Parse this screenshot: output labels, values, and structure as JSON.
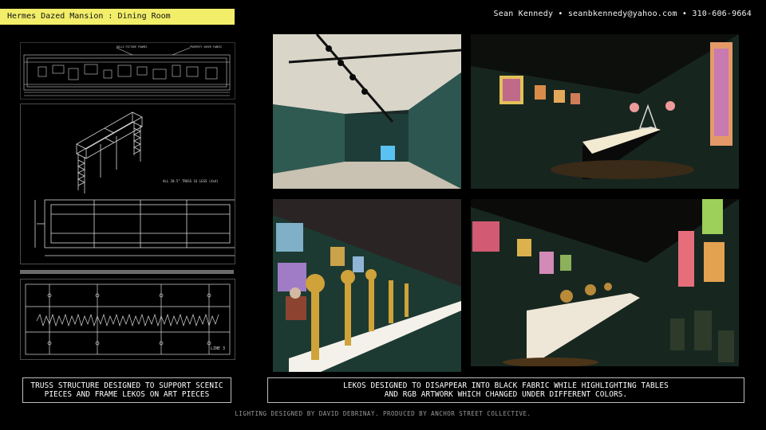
{
  "header": {
    "title": "Hermes Dazed Mansion : Dining Room",
    "contact": "Sean Kennedy • seanbkennedy@yahoo.com • 310-606-9664"
  },
  "drawings": {
    "plan_top": {
      "callout_a": "DOLLS PICTURE FRAMES",
      "callout_b": "PROPERTY SHEER FABRIC"
    },
    "truss_note": "ALL 20.5\" TRUSS 16 LEGS (4x4)",
    "lighting_label": "LINE 3"
  },
  "captions": {
    "left": [
      "TRUSS STRUCTURE DESIGNED TO SUPPORT SCENIC",
      "PIECES AND FRAME LEKOS ON ART PIECES"
    ],
    "right": [
      "LEKOS DESIGNED TO DISAPPEAR INTO BLACK FABRIC WHILE HIGHLIGHTING TABLES",
      "AND RGB ARTWORK WHICH CHANGED UNDER DIFFERENT COLORS."
    ]
  },
  "footer": "LIGHTING DESIGNED BY DAVID DEBRINAY. PRODUCED BY ANCHOR STREET COLLECTIVE.",
  "colors": {
    "title_bg": "#f2ee6a",
    "wall_green": "#2a4a44",
    "table_glow": "#f3ead2"
  },
  "icons": [
    "ceiling-truss-icon",
    "art-frame-icon",
    "candelabra-icon"
  ]
}
